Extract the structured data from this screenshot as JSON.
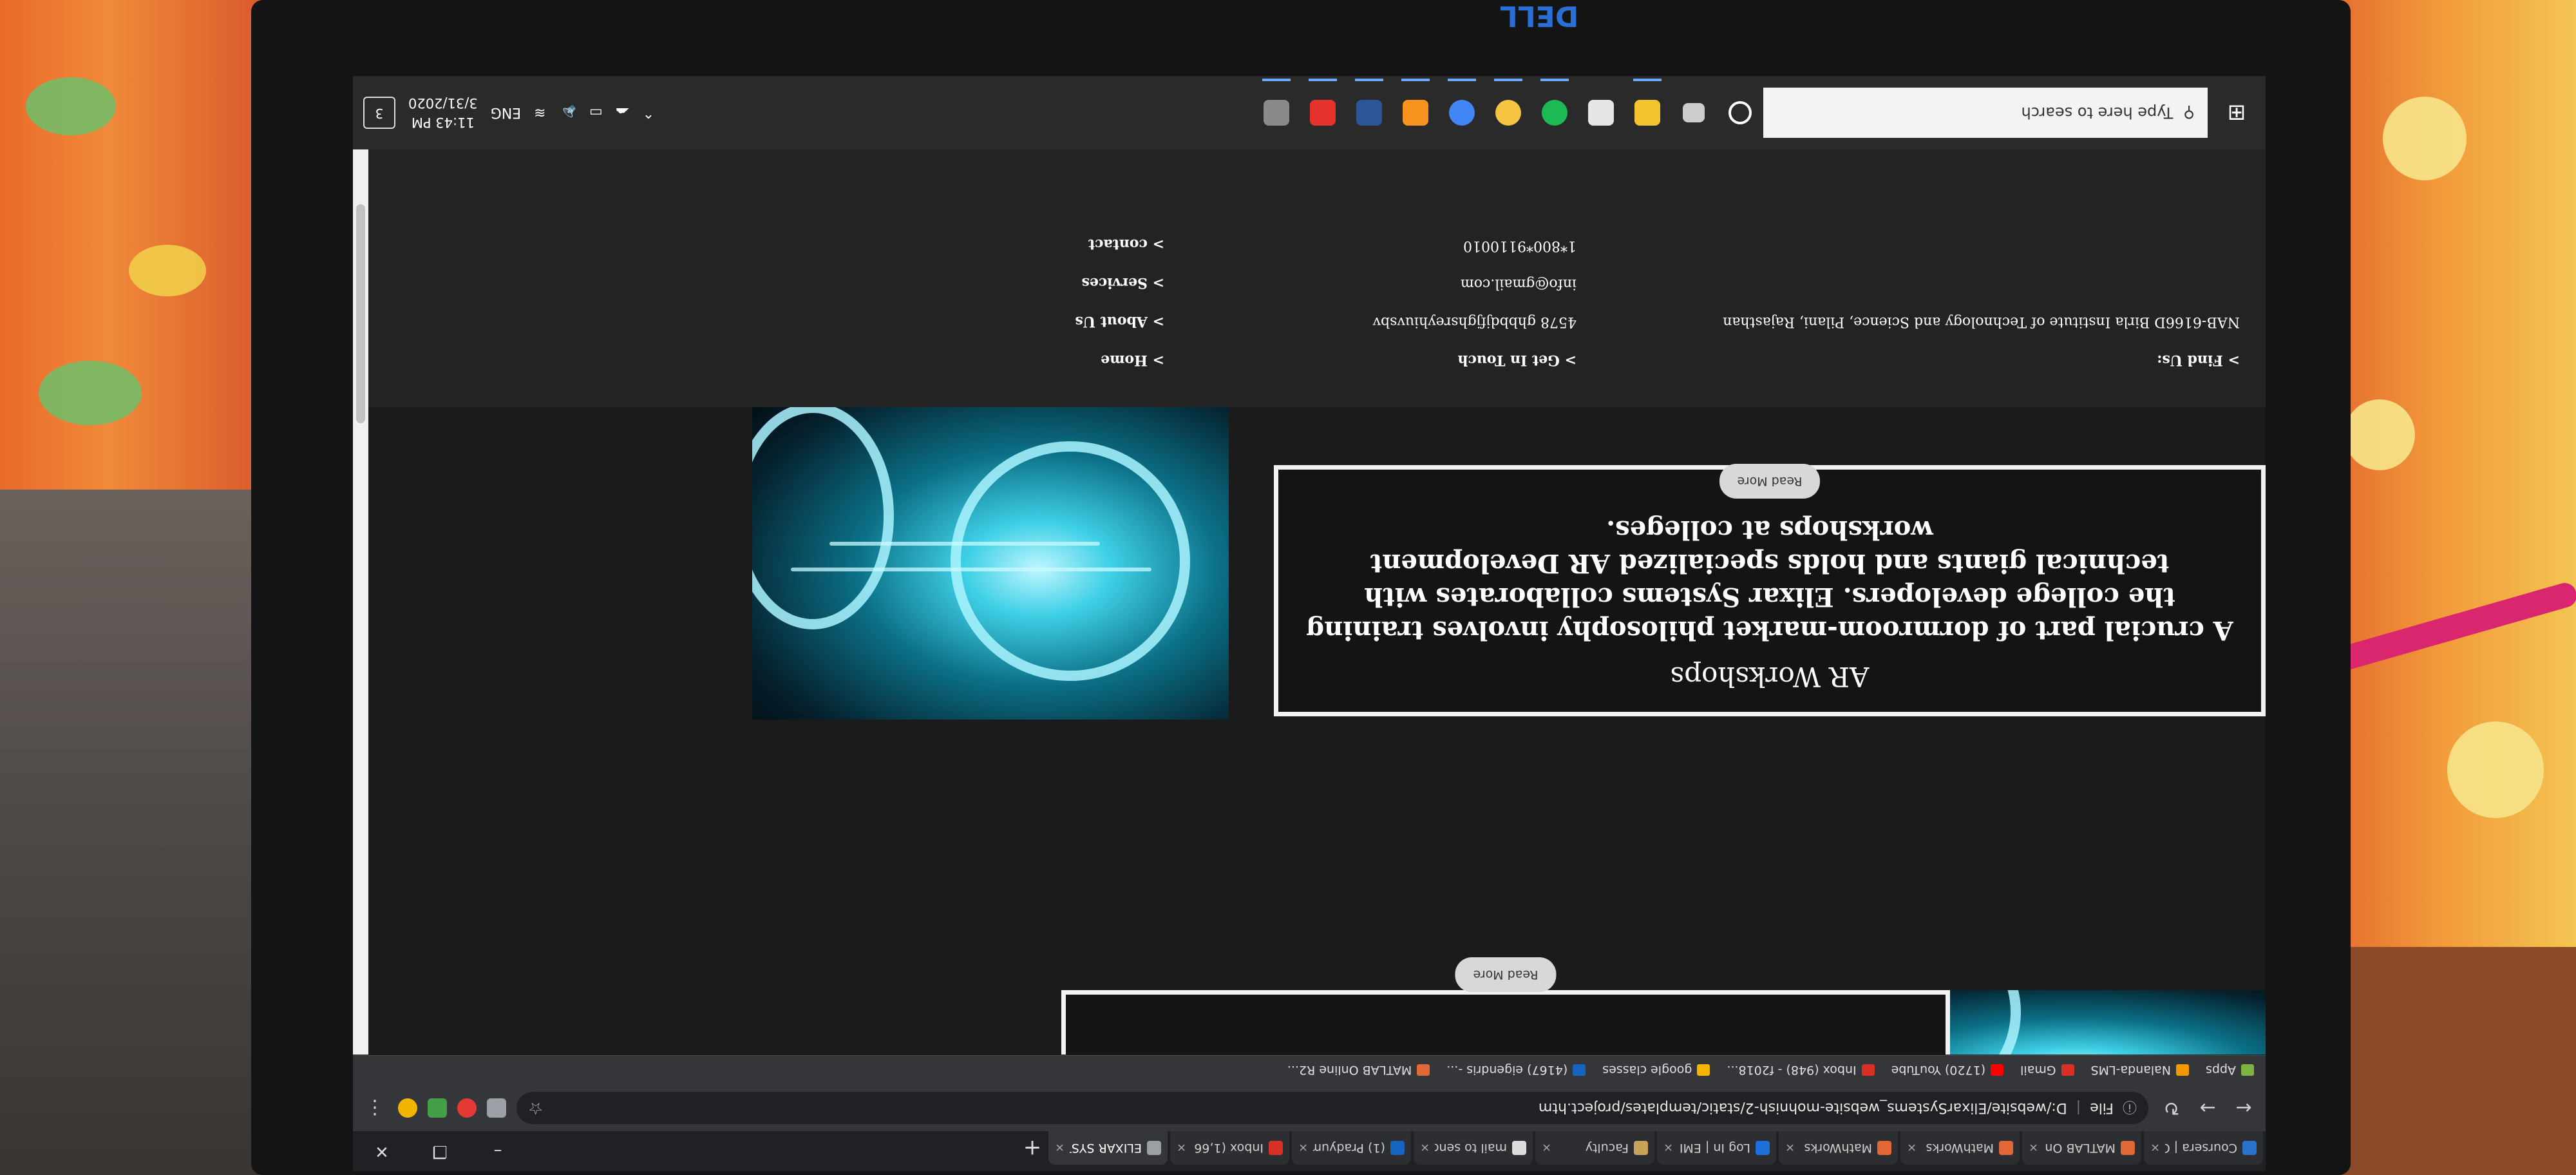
{
  "browser": {
    "tabs": [
      {
        "label": "Coursera | C",
        "color": "#2a73cc"
      },
      {
        "label": "MATLAB On",
        "color": "#e16737"
      },
      {
        "label": "MathWorks",
        "color": "#e16737"
      },
      {
        "label": "MathWorks",
        "color": "#e16737"
      },
      {
        "label": "Log In | EMI",
        "color": "#1e6fd9"
      },
      {
        "label": "Faculty",
        "color": "#c9a25a"
      },
      {
        "label": "mail to send",
        "color": "#dddddd"
      },
      {
        "label": "(1) Pradyum",
        "color": "#1565c0"
      },
      {
        "label": "Inbox (1,66",
        "color": "#d93025"
      },
      {
        "label": "ELIXAR SYST",
        "color": "#9aa0a6"
      }
    ],
    "active_tab_index": 9,
    "close_glyph": "×",
    "new_tab_glyph": "+",
    "window_buttons": {
      "minimize": "–",
      "maximize": "❐",
      "close": "✕"
    },
    "address": {
      "info_glyph": "ⓘ",
      "scheme_label": "File",
      "separator": "|",
      "url": "D:/website/ElixarSystems_website-mohnish-2/static/templates/project.htm"
    },
    "bookmarks": [
      {
        "label": "Apps",
        "color": "#7cb342"
      },
      {
        "label": "Nalanda-LMS",
        "color": "#f29900"
      },
      {
        "label": "Gmail",
        "color": "#d93025"
      },
      {
        "label": "(1720) YouTube",
        "color": "#ff0000"
      },
      {
        "label": "Inbox (948) - f2018...",
        "color": "#d93025"
      },
      {
        "label": "google classes",
        "color": "#f4b400"
      },
      {
        "label": "(4167) eigendris -...",
        "color": "#1565c0"
      },
      {
        "label": "MATLAB Online R2...",
        "color": "#e16737"
      }
    ]
  },
  "page": {
    "card1": {
      "button": "Read More"
    },
    "card2": {
      "title": "AR Workshops",
      "body": "A crucial part of dormroom-market philosophy involves training the college developers. Elixar Systems collaborates with technical giants and holds specialized AR Development workshops at colleges.",
      "button": "Read More"
    },
    "footer": {
      "find_us": "> Find Us:",
      "address": "NAB-6166D Birla Institute of Technology and Science, Pilani, Rajasthan",
      "get_in_touch": "> Get In Touch",
      "phone1": "4578 ghbbdjfjghsreyhiuvsbv",
      "email": "info@gmail.com",
      "phone2": "1*800*9110010",
      "nav": [
        "> Home",
        "> About Us",
        "> Services",
        "> contact"
      ]
    }
  },
  "taskbar": {
    "search_placeholder": "Type here to search",
    "apps": [
      {
        "name": "task-view",
        "color": "#cccccc"
      },
      {
        "name": "file-explorer",
        "color": "#f4c430"
      },
      {
        "name": "store",
        "color": "#e6e6e6"
      },
      {
        "name": "spotify",
        "color": "#1db954"
      },
      {
        "name": "chrome-canary",
        "color": "#f6c343"
      },
      {
        "name": "chrome",
        "color": "#4285f4"
      },
      {
        "name": "sublime",
        "color": "#f7931e"
      },
      {
        "name": "word",
        "color": "#2b579a"
      },
      {
        "name": "yahoo",
        "color": "#e5322d"
      },
      {
        "name": "photos",
        "color": "#8a8a8a"
      }
    ],
    "tray": {
      "lang": "ENG",
      "time": "11:43 PM",
      "date": "3/31/2020",
      "notif_count": "3"
    }
  },
  "logo_text": "DELL"
}
